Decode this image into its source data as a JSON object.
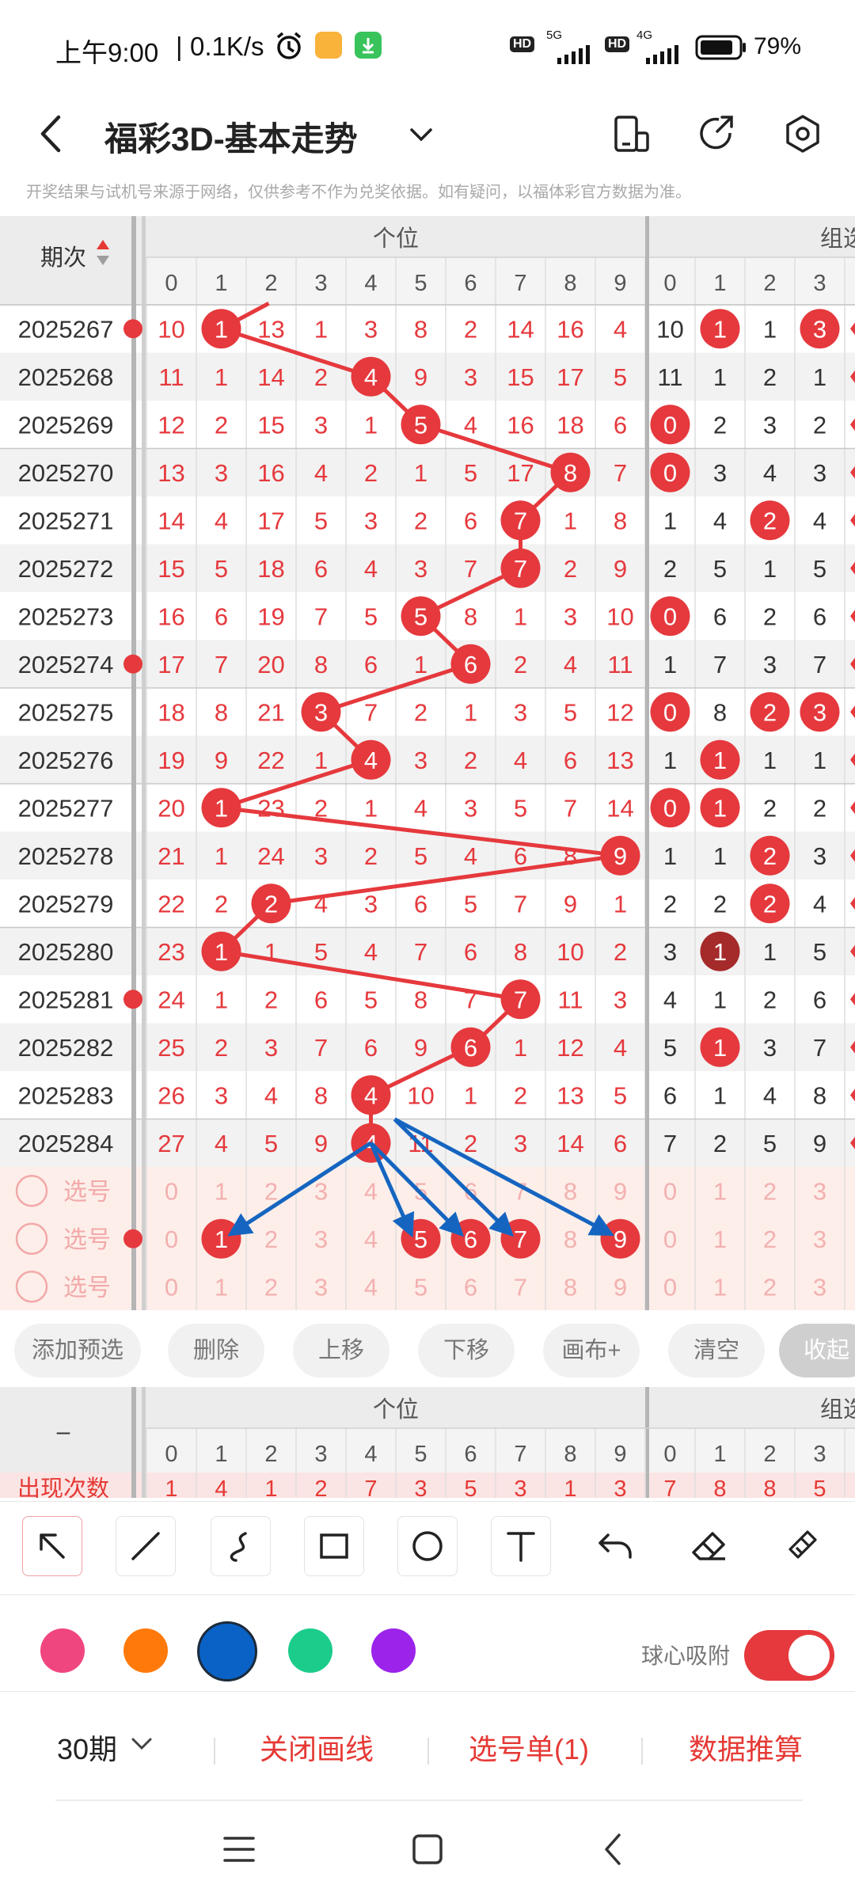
{
  "status": {
    "time": "上午9:00",
    "speed": "0.1K/s",
    "battery": "79%",
    "hd": "HD",
    "net1": "5G",
    "net2": "4G"
  },
  "title": {
    "text": "福彩3D-基本走势"
  },
  "notice": "开奖结果与试机号来源于网络，仅供参考不作为兑奖依据。如有疑问，以福体彩官方数据为准。",
  "colors": {
    "red": "#e5393d",
    "blue": "#1565c0",
    "grid_sep": "#b5b5b5",
    "stripe": "#f2f2f2",
    "select_bg": "#fdeee9"
  },
  "table": {
    "period_header": "期次",
    "group_ge": "个位",
    "group_zu": "组选",
    "digit_headers": [
      "0",
      "1",
      "2",
      "3",
      "4",
      "5",
      "6",
      "7",
      "8",
      "9"
    ],
    "zu_headers": [
      "0",
      "1",
      "2",
      "3"
    ],
    "rows": [
      {
        "period": "2025267",
        "hit": 1,
        "cells": [
          "10",
          "1",
          "13",
          "1",
          "3",
          "8",
          "2",
          "14",
          "16",
          "4"
        ],
        "zu": [
          "10",
          "1",
          "1",
          "3"
        ],
        "zu_hits": [
          1,
          3
        ],
        "edge": true
      },
      {
        "period": "2025268",
        "hit": 4,
        "cells": [
          "11",
          "1",
          "14",
          "2",
          "4",
          "9",
          "3",
          "15",
          "17",
          "5"
        ],
        "zu": [
          "11",
          "1",
          "2",
          "1"
        ],
        "zu_hits": [],
        "edge": false
      },
      {
        "period": "2025269",
        "hit": 5,
        "cells": [
          "12",
          "2",
          "15",
          "3",
          "1",
          "5",
          "4",
          "16",
          "18",
          "6"
        ],
        "zu": [
          "0",
          "2",
          "3",
          "2"
        ],
        "zu_hits": [
          0
        ],
        "edge": false
      },
      {
        "period": "2025270",
        "hit": 8,
        "cells": [
          "13",
          "3",
          "16",
          "4",
          "2",
          "1",
          "5",
          "17",
          "8",
          "7"
        ],
        "zu": [
          "0",
          "3",
          "4",
          "3"
        ],
        "zu_hits": [
          0
        ],
        "edge": false
      },
      {
        "period": "2025271",
        "hit": 7,
        "cells": [
          "14",
          "4",
          "17",
          "5",
          "3",
          "2",
          "6",
          "7",
          "1",
          "8"
        ],
        "zu": [
          "1",
          "4",
          "2",
          "4"
        ],
        "zu_hits": [
          2
        ],
        "edge": false
      },
      {
        "period": "2025272",
        "hit": 7,
        "cells": [
          "15",
          "5",
          "18",
          "6",
          "4",
          "3",
          "7",
          "7",
          "2",
          "9"
        ],
        "zu": [
          "2",
          "5",
          "1",
          "5"
        ],
        "zu_hits": [],
        "edge": false
      },
      {
        "period": "2025273",
        "hit": 5,
        "cells": [
          "16",
          "6",
          "19",
          "7",
          "5",
          "5",
          "8",
          "1",
          "3",
          "10"
        ],
        "zu": [
          "0",
          "6",
          "2",
          "6"
        ],
        "zu_hits": [
          0
        ],
        "edge": false
      },
      {
        "period": "2025274",
        "hit": 6,
        "cells": [
          "17",
          "7",
          "20",
          "8",
          "6",
          "1",
          "6",
          "2",
          "4",
          "11"
        ],
        "zu": [
          "1",
          "7",
          "3",
          "7"
        ],
        "zu_hits": [],
        "edge": true
      },
      {
        "period": "2025275",
        "hit": 3,
        "cells": [
          "18",
          "8",
          "21",
          "3",
          "7",
          "2",
          "1",
          "3",
          "5",
          "12"
        ],
        "zu": [
          "0",
          "8",
          "2",
          "3"
        ],
        "zu_hits": [
          0,
          2,
          3
        ],
        "edge": false
      },
      {
        "period": "2025276",
        "hit": 4,
        "cells": [
          "19",
          "9",
          "22",
          "1",
          "4",
          "3",
          "2",
          "4",
          "6",
          "13"
        ],
        "zu": [
          "1",
          "1",
          "1",
          "1"
        ],
        "zu_hits": [
          1
        ],
        "edge": false
      },
      {
        "period": "2025277",
        "hit": 1,
        "cells": [
          "20",
          "1",
          "23",
          "2",
          "1",
          "4",
          "3",
          "5",
          "7",
          "14"
        ],
        "zu": [
          "0",
          "1",
          "2",
          "2"
        ],
        "zu_hits": [
          0,
          1
        ],
        "edge": false
      },
      {
        "period": "2025278",
        "hit": 9,
        "cells": [
          "21",
          "1",
          "24",
          "3",
          "2",
          "5",
          "4",
          "6",
          "8",
          "9"
        ],
        "zu": [
          "1",
          "1",
          "2",
          "3"
        ],
        "zu_hits": [
          2
        ],
        "edge": false
      },
      {
        "period": "2025279",
        "hit": 2,
        "cells": [
          "22",
          "2",
          "2",
          "4",
          "3",
          "6",
          "5",
          "7",
          "9",
          "1"
        ],
        "zu": [
          "2",
          "2",
          "2",
          "4"
        ],
        "zu_hits": [
          2
        ],
        "edge": false
      },
      {
        "period": "2025280",
        "hit": 1,
        "cells": [
          "23",
          "1",
          "1",
          "5",
          "4",
          "7",
          "6",
          "8",
          "10",
          "2"
        ],
        "zu": [
          "3",
          "1",
          "1",
          "5"
        ],
        "zu_hits": [
          1
        ],
        "zu_dark": 1,
        "edge": false
      },
      {
        "period": "2025281",
        "hit": 7,
        "cells": [
          "24",
          "1",
          "2",
          "6",
          "5",
          "8",
          "7",
          "7",
          "11",
          "3"
        ],
        "zu": [
          "4",
          "1",
          "2",
          "6"
        ],
        "zu_hits": [],
        "edge": true
      },
      {
        "period": "2025282",
        "hit": 6,
        "cells": [
          "25",
          "2",
          "3",
          "7",
          "6",
          "9",
          "6",
          "1",
          "12",
          "4"
        ],
        "zu": [
          "5",
          "1",
          "3",
          "7"
        ],
        "zu_hits": [
          1
        ],
        "edge": false
      },
      {
        "period": "2025283",
        "hit": 4,
        "cells": [
          "26",
          "3",
          "4",
          "8",
          "4",
          "10",
          "1",
          "2",
          "13",
          "5"
        ],
        "zu": [
          "6",
          "1",
          "4",
          "8"
        ],
        "zu_hits": [],
        "edge": false
      },
      {
        "period": "2025284",
        "hit": 4,
        "cells": [
          "27",
          "4",
          "5",
          "9",
          "4",
          "11",
          "2",
          "3",
          "14",
          "6"
        ],
        "zu": [
          "7",
          "2",
          "5",
          "9"
        ],
        "zu_hits": [],
        "edge": false
      }
    ],
    "select_label": "选号",
    "select_rows": [
      {
        "hits": []
      },
      {
        "hits": [
          1,
          5,
          6,
          7,
          9
        ]
      },
      {
        "hits": []
      }
    ]
  },
  "actions": [
    "添加预选",
    "删除",
    "上移",
    "下移",
    "画布+",
    "清空",
    "收起"
  ],
  "summary": {
    "left": "–",
    "group_ge": "个位",
    "group_zu": "组选",
    "row_label": "出现次数",
    "values": [
      "1",
      "4",
      "1",
      "2",
      "7",
      "3",
      "5",
      "3",
      "1",
      "3"
    ],
    "zu_values": [
      "7",
      "8",
      "8",
      "5"
    ]
  },
  "tools": [
    "select-arrow",
    "line",
    "curve",
    "rectangle",
    "circle",
    "text",
    "undo",
    "eraser",
    "clear-brush"
  ],
  "palette": [
    "#f0467f",
    "#ff7a0a",
    "#0a62c7",
    "#1bcc8a",
    "#9b23ea"
  ],
  "snap": {
    "label": "球心吸附",
    "on": true
  },
  "bottom_nav": {
    "periods": "30期",
    "close_draw": "关闭画线",
    "pick_list": "选号单(1)",
    "calc": "数据推算"
  }
}
